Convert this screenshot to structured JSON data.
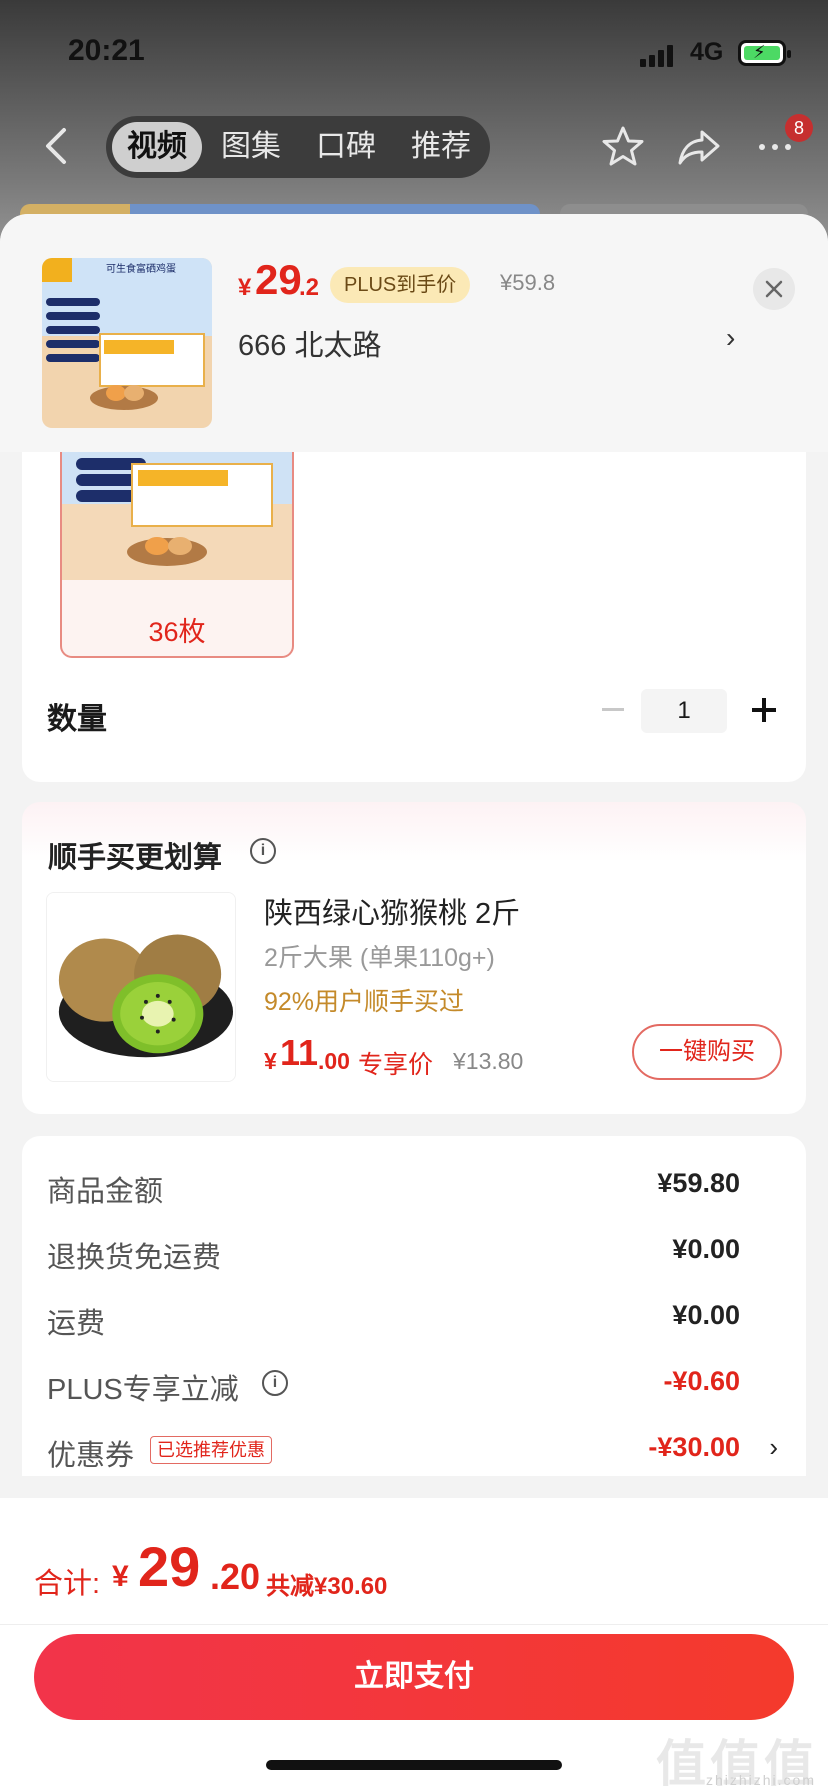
{
  "status_bar": {
    "time": "20:21",
    "network": "4G"
  },
  "top_nav": {
    "tabs": [
      "视频",
      "图集",
      "口碑",
      "推荐"
    ],
    "active_tab": "视频",
    "notification_count": "8"
  },
  "sheet_header": {
    "price_currency": "¥",
    "price_integer": "29",
    "price_decimal": ".2",
    "plus_tag": "PLUS到手价",
    "original_price": "¥59.8",
    "address": "666  北太路",
    "product_box_title": "可生食富硒鸡蛋"
  },
  "spec": {
    "selected_label": "36枚",
    "quantity_label": "数量",
    "quantity_value": "1"
  },
  "bundle": {
    "title": "顺手买更划算",
    "product_name": "陕西绿心猕猴桃 2斤",
    "product_spec": "2斤大果 (单果110g+)",
    "buyers_text": "92%用户顺手买过",
    "price_currency": "¥",
    "price_integer": "11",
    "price_decimal": ".00",
    "price_tag": "专享价",
    "original_price": "¥13.80",
    "buy_button": "一键购买"
  },
  "summary": {
    "rows": [
      {
        "label": "商品金额",
        "value": "¥59.80"
      },
      {
        "label": "退换货免运费",
        "value": "¥0.00"
      },
      {
        "label": "运费",
        "value": "¥0.00"
      },
      {
        "label": "PLUS专享立减",
        "value": "-¥0.60"
      },
      {
        "label": "优惠券",
        "value": "-¥30.00"
      }
    ],
    "coupon_tag": "已选推荐优惠"
  },
  "footer": {
    "total_label": "合计:",
    "total_currency": "¥",
    "total_integer": "29",
    "total_decimal": ".20",
    "savings": "共减¥30.60",
    "pay_button": "立即支付"
  },
  "watermark": {
    "main": "值值值",
    "sub": "zhizhizhi.com"
  },
  "colors": {
    "accent_red": "#e1251b",
    "plus_gold": "#fbe9b6",
    "button_gradient_start": "#f2344a",
    "button_gradient_end": "#f43a2c"
  }
}
